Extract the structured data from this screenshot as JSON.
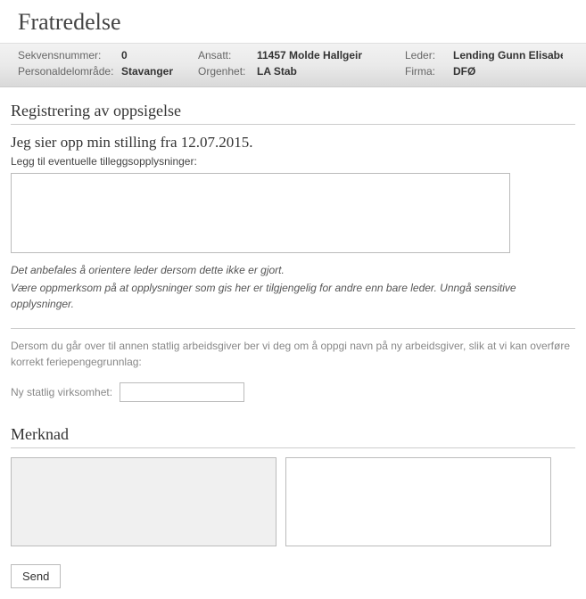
{
  "page_title": "Fratredelse",
  "header": {
    "seq_label": "Sekvensnummer:",
    "seq_value": "0",
    "area_label": "Personaldelområde:",
    "area_value": "Stavanger",
    "ansatt_label": "Ansatt:",
    "ansatt_value": "11457 Molde Hallgeir",
    "orgenhet_label": "Orgenhet:",
    "orgenhet_value": "LA Stab",
    "leder_label": "Leder:",
    "leder_value": "Lending Gunn Elisabeth Løl",
    "firma_label": "Firma:",
    "firma_value": "DFØ"
  },
  "section1_heading": "Registrering av oppsigelse",
  "statement": "Jeg sier opp min stilling fra 12.07.2015.",
  "extra_label": "Legg til eventuelle tilleggsopplysninger:",
  "extra_value": "",
  "note1": "Det anbefales å orientere leder dersom dette ikke er gjort.",
  "note2": "Være oppmerksom på at opplysninger som gis her er tilgjengelig for andre enn bare leder. Unngå sensitive opplysninger.",
  "transfer_text": "Dersom du går over til annen statlig arbeidsgiver ber vi deg om å oppgi navn på ny arbeidsgiver, slik at vi kan overføre korrekt feriepengegrunnlag:",
  "new_employer_label": "Ny statlig virksomhet:",
  "new_employer_value": "",
  "merknad_heading": "Merknad",
  "merk_left": "",
  "merk_right": "",
  "send_label": "Send"
}
